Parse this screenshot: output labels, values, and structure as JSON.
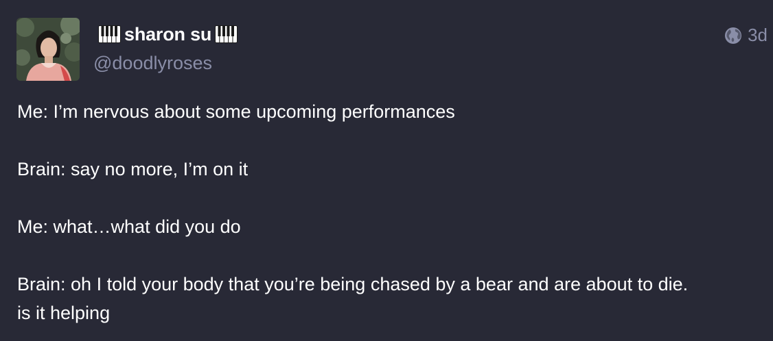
{
  "author": {
    "display_name": "sharon su",
    "handle": "@doodlyroses",
    "emoji_left": "piano-keys-icon",
    "emoji_right": "piano-keys-icon"
  },
  "meta": {
    "visibility_icon": "globe-icon",
    "time": "3d"
  },
  "content": {
    "paragraphs": [
      [
        "Me: I’m nervous about some upcoming performances"
      ],
      [
        "Brain: say no more, I’m on it"
      ],
      [
        "Me: what…what did you do"
      ],
      [
        "Brain: oh I told your body that you’re being chased by a bear and are about to die.",
        "is it helping"
      ]
    ]
  },
  "colors": {
    "background": "#282936",
    "text": "#ffffff",
    "muted": "#8a8ea8"
  }
}
